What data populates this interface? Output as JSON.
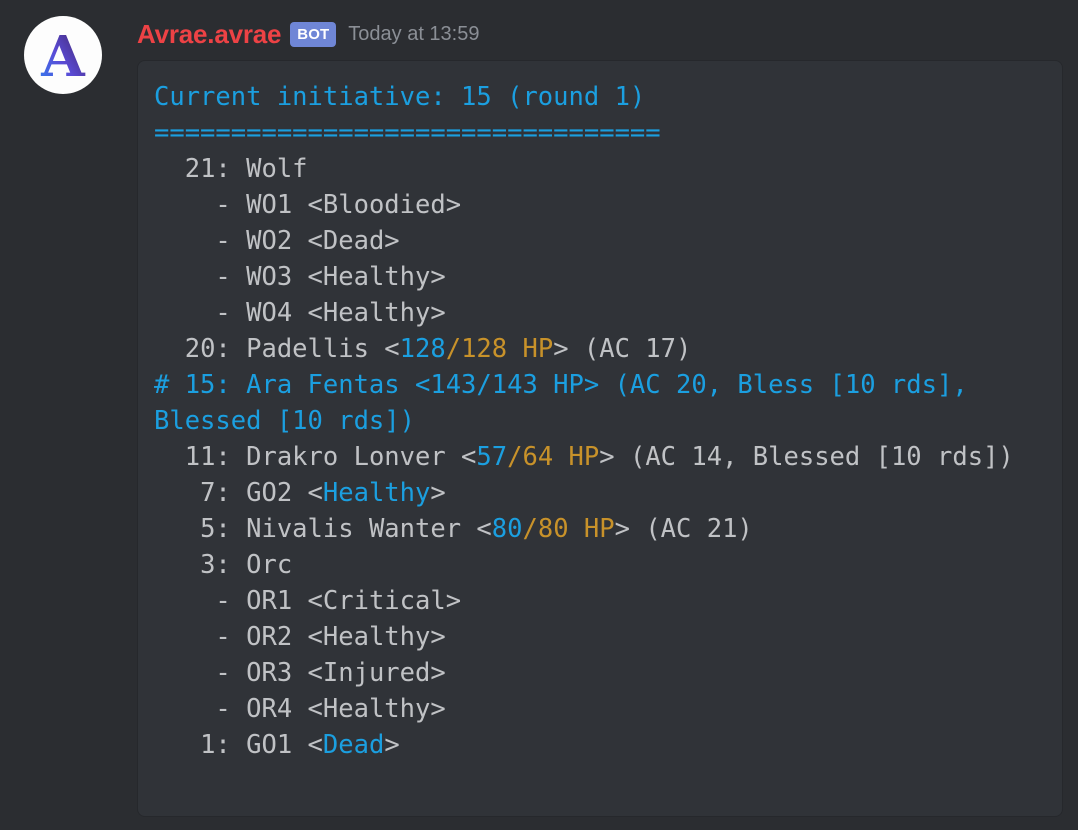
{
  "message": {
    "author": "Avrae.avrae",
    "bot_badge": "BOT",
    "timestamp": "Today at 13:59",
    "avatar_letter": "A",
    "author_color": "#ed4245",
    "bot_badge_color": "#6f86d6",
    "timestamp_color": "#8b8f96"
  },
  "colors": {
    "page_background": "#2b2d31",
    "code_background": "#303338",
    "code_border": "#26282c",
    "cyan": "#1b9fe0",
    "orange": "#c8922a",
    "gray": "#c0c2c5"
  },
  "codeblock": {
    "header_title": "Current initiative: 15 (round 1)",
    "separator": "=================================",
    "lines": [
      {
        "id": "line-header",
        "segments": [
          {
            "text": "Current initiative: 15 (round 1)",
            "color": "cyan"
          }
        ]
      },
      {
        "id": "line-separator",
        "segments": [
          {
            "text": "=================================",
            "color": "cyan"
          }
        ]
      },
      {
        "id": "line-wolf-group",
        "segments": [
          {
            "text": "  21: Wolf",
            "color": "gray"
          }
        ]
      },
      {
        "id": "line-wo1",
        "segments": [
          {
            "text": "    - WO1 <Bloodied>",
            "color": "gray"
          }
        ]
      },
      {
        "id": "line-wo2",
        "segments": [
          {
            "text": "    - WO2 <Dead>",
            "color": "gray"
          }
        ]
      },
      {
        "id": "line-wo3",
        "segments": [
          {
            "text": "    - WO3 <Healthy>",
            "color": "gray"
          }
        ]
      },
      {
        "id": "line-wo4",
        "segments": [
          {
            "text": "    - WO4 <Healthy>",
            "color": "gray"
          }
        ]
      },
      {
        "id": "line-padellis",
        "segments": [
          {
            "text": "  20: Padellis <",
            "color": "gray"
          },
          {
            "text": "128",
            "color": "cyan"
          },
          {
            "text": "/128 HP",
            "color": "orange"
          },
          {
            "text": "> (AC 17)",
            "color": "gray"
          }
        ]
      },
      {
        "id": "line-ara-fentas",
        "segments": [
          {
            "text": "# 15: Ara Fentas <143/143 HP> (AC 20, Bless [10 rds], Blessed [10 rds])",
            "color": "cyan"
          }
        ]
      },
      {
        "id": "line-drakro-lonver",
        "segments": [
          {
            "text": "  11: Drakro Lonver <",
            "color": "gray"
          },
          {
            "text": "57",
            "color": "cyan"
          },
          {
            "text": "/64 HP",
            "color": "orange"
          },
          {
            "text": "> (AC 14, Blessed [10 rds])",
            "color": "gray"
          }
        ]
      },
      {
        "id": "line-go2",
        "segments": [
          {
            "text": "   7: GO2 <",
            "color": "gray"
          },
          {
            "text": "Healthy",
            "color": "cyan"
          },
          {
            "text": ">",
            "color": "gray"
          }
        ]
      },
      {
        "id": "line-nivalis-wanter",
        "segments": [
          {
            "text": "   5: Nivalis Wanter <",
            "color": "gray"
          },
          {
            "text": "80",
            "color": "cyan"
          },
          {
            "text": "/80 HP",
            "color": "orange"
          },
          {
            "text": "> (AC 21)",
            "color": "gray"
          }
        ]
      },
      {
        "id": "line-orc-group",
        "segments": [
          {
            "text": "   3: Orc",
            "color": "gray"
          }
        ]
      },
      {
        "id": "line-or1",
        "segments": [
          {
            "text": "    - OR1 <Critical>",
            "color": "gray"
          }
        ]
      },
      {
        "id": "line-or2",
        "segments": [
          {
            "text": "    - OR2 <Healthy>",
            "color": "gray"
          }
        ]
      },
      {
        "id": "line-or3",
        "segments": [
          {
            "text": "    - OR3 <Injured>",
            "color": "gray"
          }
        ]
      },
      {
        "id": "line-or4",
        "segments": [
          {
            "text": "    - OR4 <Healthy>",
            "color": "gray"
          }
        ]
      },
      {
        "id": "line-go1",
        "segments": [
          {
            "text": "   1: GO1 <",
            "color": "gray"
          },
          {
            "text": "Dead",
            "color": "cyan"
          },
          {
            "text": ">",
            "color": "gray"
          }
        ]
      }
    ],
    "combatants": [
      {
        "initiative": 21,
        "name": "Wolf",
        "is_group": true,
        "current_turn": false,
        "members": [
          {
            "name": "WO1",
            "status": "Bloodied"
          },
          {
            "name": "WO2",
            "status": "Dead"
          },
          {
            "name": "WO3",
            "status": "Healthy"
          },
          {
            "name": "WO4",
            "status": "Healthy"
          }
        ]
      },
      {
        "initiative": 20,
        "name": "Padellis",
        "is_group": false,
        "current_turn": false,
        "hp_current": 128,
        "hp_max": 128,
        "ac": 17,
        "effects": []
      },
      {
        "initiative": 15,
        "name": "Ara Fentas",
        "is_group": false,
        "current_turn": true,
        "hp_current": 143,
        "hp_max": 143,
        "ac": 20,
        "effects": [
          "Bless [10 rds]",
          "Blessed [10 rds]"
        ]
      },
      {
        "initiative": 11,
        "name": "Drakro Lonver",
        "is_group": false,
        "current_turn": false,
        "hp_current": 57,
        "hp_max": 64,
        "ac": 14,
        "effects": [
          "Blessed [10 rds]"
        ]
      },
      {
        "initiative": 7,
        "name": "GO2",
        "is_group": false,
        "current_turn": false,
        "status": "Healthy"
      },
      {
        "initiative": 5,
        "name": "Nivalis Wanter",
        "is_group": false,
        "current_turn": false,
        "hp_current": 80,
        "hp_max": 80,
        "ac": 21,
        "effects": []
      },
      {
        "initiative": 3,
        "name": "Orc",
        "is_group": true,
        "current_turn": false,
        "members": [
          {
            "name": "OR1",
            "status": "Critical"
          },
          {
            "name": "OR2",
            "status": "Healthy"
          },
          {
            "name": "OR3",
            "status": "Injured"
          },
          {
            "name": "OR4",
            "status": "Healthy"
          }
        ]
      },
      {
        "initiative": 1,
        "name": "GO1",
        "is_group": false,
        "current_turn": false,
        "status": "Dead"
      }
    ],
    "round": 1,
    "current_initiative": 15
  }
}
